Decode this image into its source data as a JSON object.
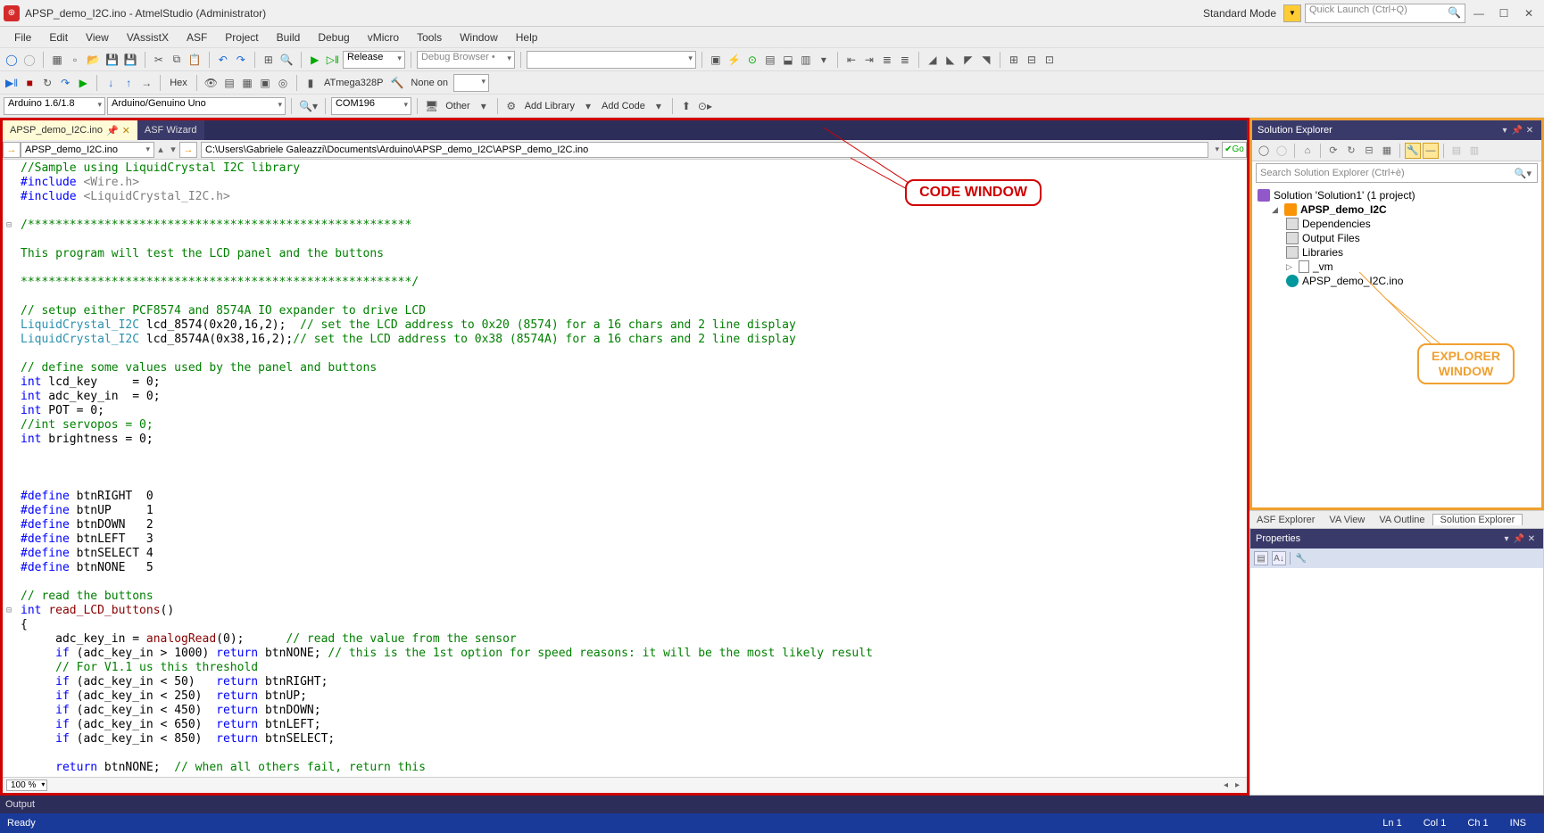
{
  "window": {
    "title": "APSP_demo_I2C.ino - AtmelStudio (Administrator)",
    "standard_mode": "Standard Mode",
    "quick_launch_placeholder": "Quick Launch (Ctrl+Q)"
  },
  "menu": [
    "File",
    "Edit",
    "View",
    "VAssistX",
    "ASF",
    "Project",
    "Build",
    "Debug",
    "vMicro",
    "Tools",
    "Window",
    "Help"
  ],
  "toolbar1": {
    "config": "Release",
    "debug_browser": "Debug Browser •"
  },
  "toolbar2": {
    "hex": "Hex",
    "device": "ATmega328P",
    "none_on": "None on",
    "none_on_value": ""
  },
  "toolbar3": {
    "board_family": "Arduino 1.6/1.8",
    "board": "Arduino/Genuino Uno",
    "port": "COM196",
    "other": "Other",
    "add_library": "Add Library",
    "add_code": "Add Code"
  },
  "tabs": {
    "active": "APSP_demo_I2C.ino",
    "second": "ASF Wizard"
  },
  "nav": {
    "scope": "APSP_demo_I2C.ino",
    "path": "C:\\Users\\Gabriele Galeazzi\\Documents\\Arduino\\APSP_demo_I2C\\APSP_demo_I2C.ino",
    "go": "Go"
  },
  "code_lines": [
    {
      "t": "//Sample using LiquidCrystal I2C library",
      "cls": "c-comment"
    },
    {
      "raw": "<span class='c-keyword'>#include</span> <span class='c-include'>&lt;Wire.h&gt;</span>"
    },
    {
      "raw": "<span class='c-keyword'>#include</span> <span class='c-include'>&lt;LiquidCrystal_I2C.h&gt;</span>"
    },
    {
      "t": ""
    },
    {
      "t": "/*******************************************************",
      "cls": "c-comment",
      "gutter": "⊟"
    },
    {
      "t": ""
    },
    {
      "t": "This program will test the LCD panel and the buttons",
      "cls": "c-comment"
    },
    {
      "t": ""
    },
    {
      "t": "********************************************************/",
      "cls": "c-comment"
    },
    {
      "t": ""
    },
    {
      "t": "// setup either PCF8574 and 8574A IO expander to drive LCD",
      "cls": "c-comment"
    },
    {
      "raw": "<span class='c-type'>LiquidCrystal_I2C</span> lcd_8574(0x20,16,2);  <span class='c-comment'>// set the LCD address to 0x20 (8574) for a 16 chars and 2 line display</span>"
    },
    {
      "raw": "<span class='c-type'>LiquidCrystal_I2C</span> lcd_8574A(0x38,16,2);<span class='c-comment'>// set the LCD address to 0x38 (8574A) for a 16 chars and 2 line display</span>"
    },
    {
      "t": ""
    },
    {
      "t": "// define some values used by the panel and buttons",
      "cls": "c-comment"
    },
    {
      "raw": "<span class='c-keyword'>int</span> lcd_key     = 0;"
    },
    {
      "raw": "<span class='c-keyword'>int</span> adc_key_in  = 0;"
    },
    {
      "raw": "<span class='c-keyword'>int</span> POT = 0;"
    },
    {
      "t": "//int servopos = 0;",
      "cls": "c-comment"
    },
    {
      "raw": "<span class='c-keyword'>int</span> brightness = 0;"
    },
    {
      "t": ""
    },
    {
      "t": ""
    },
    {
      "t": ""
    },
    {
      "raw": "<span class='c-keyword'>#define</span> btnRIGHT  0"
    },
    {
      "raw": "<span class='c-keyword'>#define</span> btnUP     1"
    },
    {
      "raw": "<span class='c-keyword'>#define</span> btnDOWN   2"
    },
    {
      "raw": "<span class='c-keyword'>#define</span> btnLEFT   3"
    },
    {
      "raw": "<span class='c-keyword'>#define</span> btnSELECT 4"
    },
    {
      "raw": "<span class='c-keyword'>#define</span> btnNONE   5"
    },
    {
      "t": ""
    },
    {
      "t": "// read the buttons",
      "cls": "c-comment"
    },
    {
      "raw": "<span class='c-keyword'>int</span> <span class='c-func'>read_LCD_buttons</span>()",
      "gutter": "⊟"
    },
    {
      "t": "{"
    },
    {
      "raw": "     adc_key_in = <span class='c-func'>analogRead</span>(0);      <span class='c-comment'>// read the value from the sensor</span>"
    },
    {
      "raw": "     <span class='c-keyword'>if</span> (adc_key_in &gt; 1000) <span class='c-keyword'>return</span> btnNONE; <span class='c-comment'>// this is the 1st option for speed reasons: it will be the most likely result</span>"
    },
    {
      "t": "     // For V1.1 us this threshold",
      "cls": "c-comment"
    },
    {
      "raw": "     <span class='c-keyword'>if</span> (adc_key_in &lt; 50)   <span class='c-keyword'>return</span> btnRIGHT;"
    },
    {
      "raw": "     <span class='c-keyword'>if</span> (adc_key_in &lt; 250)  <span class='c-keyword'>return</span> btnUP;"
    },
    {
      "raw": "     <span class='c-keyword'>if</span> (adc_key_in &lt; 450)  <span class='c-keyword'>return</span> btnDOWN;"
    },
    {
      "raw": "     <span class='c-keyword'>if</span> (adc_key_in &lt; 650)  <span class='c-keyword'>return</span> btnLEFT;"
    },
    {
      "raw": "     <span class='c-keyword'>if</span> (adc_key_in &lt; 850)  <span class='c-keyword'>return</span> btnSELECT;"
    },
    {
      "t": ""
    },
    {
      "raw": "     <span class='c-keyword'>return</span> btnNONE;  <span class='c-comment'>// when all others fail, return this</span>"
    }
  ],
  "zoom": "100 %",
  "callouts": {
    "code_window": "CODE WINDOW",
    "explorer_window": "EXPLORER\nWINDOW"
  },
  "explorer": {
    "title": "Solution Explorer",
    "search_placeholder": "Search Solution Explorer (Ctrl+è)",
    "nodes": {
      "solution": "Solution 'Solution1' (1 project)",
      "project": "APSP_demo_I2C",
      "deps": "Dependencies",
      "outputs": "Output Files",
      "libs": "Libraries",
      "vm": "_vm",
      "ino": "APSP_demo_I2C.ino"
    },
    "tabs": [
      "ASF Explorer",
      "VA View",
      "VA Outline",
      "Solution Explorer"
    ]
  },
  "properties": {
    "title": "Properties"
  },
  "output": {
    "title": "Output"
  },
  "status": {
    "ready": "Ready",
    "ln": "Ln 1",
    "col": "Col 1",
    "ch": "Ch 1",
    "ins": "INS"
  }
}
